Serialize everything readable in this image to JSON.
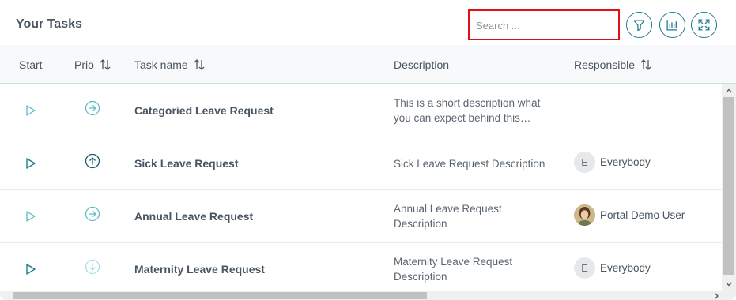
{
  "header": {
    "title": "Your Tasks"
  },
  "search": {
    "placeholder": "Search ..."
  },
  "toolbar": {
    "icons": [
      "filter-icon",
      "chart-icon",
      "expand-icon"
    ]
  },
  "columns": {
    "start": "Start",
    "prio": "Prio",
    "task_name": "Task name",
    "description": "Description",
    "responsible": "Responsible"
  },
  "rows": [
    {
      "name": "Categoried Leave Request",
      "desc_line1": "This is a short description what",
      "desc_line2": "you can expect behind this…",
      "responsible": "",
      "priority": "normal",
      "start_state": "inactive"
    },
    {
      "name": "Sick Leave Request",
      "desc_line1": "Sick Leave Request Description",
      "desc_line2": "",
      "responsible": "Everybody",
      "avatar_letter": "E",
      "priority": "high",
      "start_state": "active"
    },
    {
      "name": "Annual Leave Request",
      "desc_line1": "Annual Leave Request",
      "desc_line2": "Description",
      "responsible": "Portal Demo User",
      "priority": "normal",
      "start_state": "inactive"
    },
    {
      "name": "Maternity Leave Request",
      "desc_line1": "Maternity Leave Request",
      "desc_line2": "Description",
      "responsible": "Everybody",
      "avatar_letter": "E",
      "priority": "low",
      "start_state": "active"
    }
  ],
  "colors": {
    "accent": "#1a7c8e",
    "light_accent": "#5bbac5",
    "search_border": "#e0101a"
  }
}
